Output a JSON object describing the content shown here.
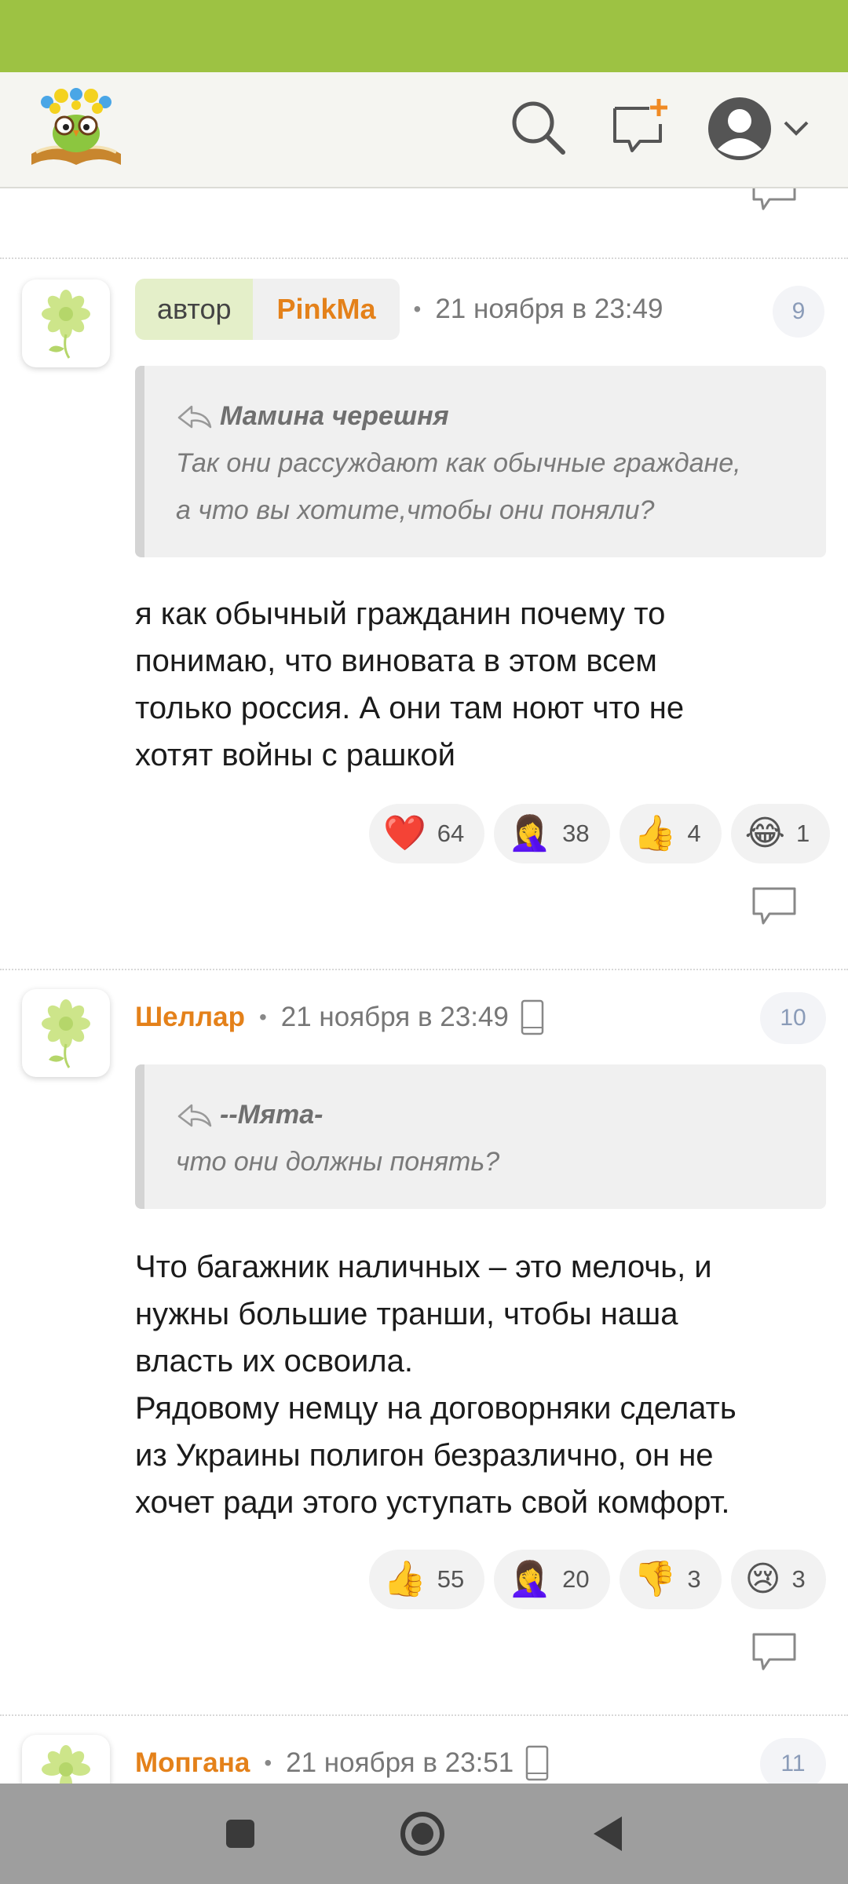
{
  "app": {
    "colors": {
      "accent": "#9dc243",
      "username": "#e4811a"
    }
  },
  "header": {
    "logo": "owl-book-logo",
    "icons": [
      "search-icon",
      "new-post-icon",
      "profile-avatar-icon",
      "chevron-down-icon"
    ]
  },
  "comments": [
    {
      "author_badge": "автор",
      "author": "PinkMa",
      "time": "21 ноября в 23:49",
      "number": "9",
      "quote": {
        "author": "Мамина черешня",
        "lines": [
          "Так они рассуждают как обычные граждане,",
          "а что вы хотите,чтобы они поняли?"
        ]
      },
      "body": [
        "я как обычный гражданин почему то",
        "понимаю, что виновата в этом всем",
        "только россия. А они там ноют что не",
        "хотят войны с рашкой"
      ],
      "reactions": [
        {
          "emoji": "❤️",
          "count": "64"
        },
        {
          "emoji": "🤦‍♀️",
          "count": "38"
        },
        {
          "emoji": "👍",
          "count": "4"
        },
        {
          "emoji": "😂",
          "count": "1"
        }
      ]
    },
    {
      "author": "Шеллар",
      "time": "21 ноября в 23:49",
      "number": "10",
      "quote": {
        "author": "--Мята-",
        "lines": [
          "что они должны понять?"
        ]
      },
      "body": [
        "Что багажник наличных – это мелочь, и",
        "нужны большие транши, чтобы наша",
        "власть их освоила.",
        "Рядовому немцу на договорняки сделать",
        "из Украины полигон безразлично, он не",
        "хочет ради этого уступать свой комфорт."
      ],
      "reactions": [
        {
          "emoji": "👍",
          "count": "55"
        },
        {
          "emoji": "🤦‍♀️",
          "count": "20"
        },
        {
          "emoji": "👎",
          "count": "3"
        },
        {
          "emoji": "😢",
          "count": "3"
        }
      ]
    },
    {
      "author": "Мопгана",
      "time": "21 ноября в 23:51",
      "number": "11"
    }
  ],
  "navbar": {
    "icons": [
      "recents-square-icon",
      "home-circle-icon",
      "back-triangle-icon"
    ]
  }
}
